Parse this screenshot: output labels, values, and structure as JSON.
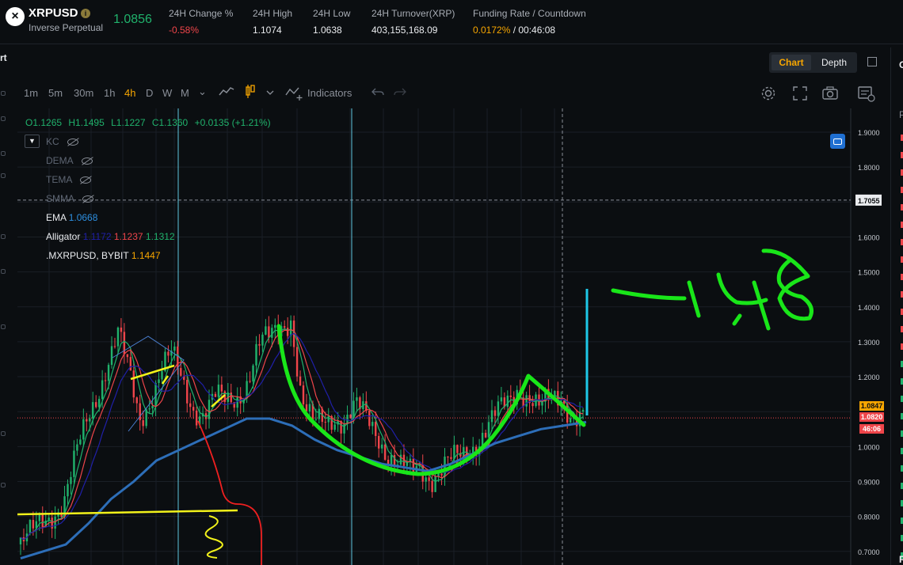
{
  "ticker": {
    "close_icon": "close-icon",
    "symbol": "XRPUSD",
    "info_icon": "i",
    "subtitle": "Inverse Perpetual",
    "last_price": "1.0856",
    "stats": [
      {
        "label": "24H Change %",
        "value": "-0.58%"
      },
      {
        "label": "24H High",
        "value": "1.1074"
      },
      {
        "label": "24H Low",
        "value": "1.0638"
      },
      {
        "label": "24H Turnover(XRP)",
        "value": "403,155,168.09"
      },
      {
        "label": "Funding Rate / Countdown",
        "value": "0.0172%",
        "value2": " / 00:46:08"
      }
    ]
  },
  "left_panel": {
    "label": "rt"
  },
  "view_toggle": {
    "chart": "Chart",
    "depth": "Depth"
  },
  "toolbar": {
    "timeframes": [
      "1m",
      "5m",
      "30m",
      "1h",
      "4h",
      "D",
      "W",
      "M"
    ],
    "active_timeframe": "4h",
    "indicators_label": "Indicators"
  },
  "legend": {
    "ohlc": {
      "open": "O1.1265",
      "high": "H1.1495",
      "low": "L1.1227",
      "close": "C1.1360",
      "change": "+0.0135 (+1.21%)"
    },
    "hidden": [
      "KC",
      "DEMA",
      "TEMA",
      "SMMA"
    ],
    "ema": {
      "name": "EMA",
      "value": "1.0668"
    },
    "alligator": {
      "name": "Alligator",
      "v1": "1.1172",
      "v2": "1.1237",
      "v3": "1.1312"
    },
    "index": {
      "name": ".MXRPUSD, BYBIT",
      "value": "1.1447"
    }
  },
  "price_axis": {
    "ticks": [
      "1.9000",
      "1.8000",
      "1.7055",
      "1.6000",
      "1.5000",
      "1.4000",
      "1.3000",
      "1.2000",
      "1.0000",
      "0.9000",
      "0.8000",
      "0.7000"
    ],
    "crosshair_price": "1.7055",
    "tag_mark": "1.0847",
    "tag_last": "1.0820",
    "countdown": "46:06"
  },
  "annotation": {
    "handwritten": "148"
  },
  "right_col": {
    "top": "O",
    "header": "P",
    "bottom": "R"
  },
  "colors": {
    "up": "#20b26c",
    "down": "#ef454a",
    "accent": "#f7a600",
    "ema": "#2d6eb8",
    "drawing_green": "#19e619",
    "drawing_cyan": "#1ec8e8",
    "drawing_yellow": "#f2f21a"
  },
  "chart_data": {
    "type": "candlestick",
    "y_unit": "XRPUSD price",
    "ylim": [
      0.67,
      1.93
    ],
    "close_path": [
      0.72,
      0.74,
      0.78,
      0.82,
      0.85,
      0.95,
      1.05,
      1.15,
      1.25,
      1.32,
      1.2,
      1.08,
      1.15,
      1.22,
      1.25,
      1.18,
      1.12,
      1.1,
      1.13,
      1.12,
      1.15,
      1.2,
      1.28,
      1.3,
      1.35,
      1.38,
      1.12,
      1.05,
      1.08,
      1.1,
      1.07,
      1.1,
      1.08,
      1.05,
      0.98,
      0.93,
      0.92,
      0.95,
      0.92,
      0.93,
      0.95,
      0.98,
      1.02,
      1.05,
      1.08,
      1.12,
      1.18,
      1.15,
      1.1,
      1.12,
      1.15,
      1.1,
      1.085
    ],
    "ema_path": [
      0.68,
      0.7,
      0.72,
      0.78,
      0.85,
      0.9,
      0.96,
      0.99,
      1.02,
      1.05,
      1.08,
      1.08,
      1.06,
      1.02,
      0.99,
      0.97,
      0.95,
      0.94,
      0.93,
      0.95,
      0.98,
      1.01,
      1.03,
      1.05,
      1.06,
      1.07
    ]
  }
}
